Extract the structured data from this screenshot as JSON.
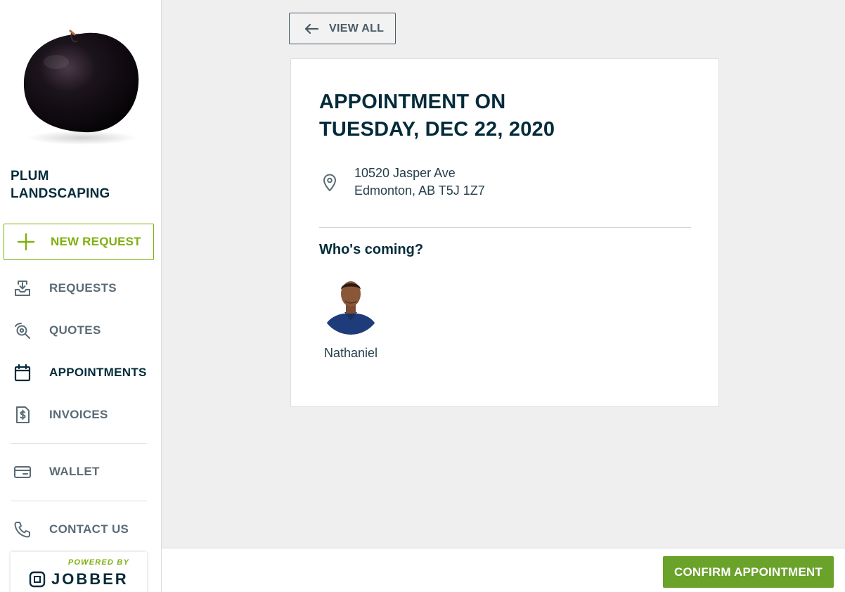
{
  "sidebar": {
    "company_name": "PLUM LANDSCAPING",
    "new_request_label": "NEW REQUEST",
    "nav": [
      {
        "label": "REQUESTS",
        "icon": "inbox-download-icon",
        "active": false
      },
      {
        "label": "QUOTES",
        "icon": "quote-magnifier-icon",
        "active": false
      },
      {
        "label": "APPOINTMENTS",
        "icon": "calendar-icon",
        "active": true
      },
      {
        "label": "INVOICES",
        "icon": "invoice-dollar-icon",
        "active": false
      },
      {
        "label": "WALLET",
        "icon": "credit-card-icon",
        "active": false
      },
      {
        "label": "CONTACT US",
        "icon": "phone-icon",
        "active": false
      }
    ],
    "powered_by": "POWERED BY",
    "brand": "JOBBER"
  },
  "main": {
    "view_all_label": "VIEW ALL",
    "appointment": {
      "title_line1": "APPOINTMENT ON",
      "title_line2": "TUESDAY, DEC 22, 2020",
      "address_line1": "10520 Jasper Ave",
      "address_line2": "Edmonton, AB T5J 1Z7",
      "who_heading": "Who's coming?",
      "people": [
        {
          "name": "Nathaniel"
        }
      ]
    }
  },
  "footer": {
    "confirm_label": "CONFIRM APPOINTMENT"
  },
  "colors": {
    "brand_green": "#7db00e",
    "confirm_green": "#6aa22a",
    "navy": "#032b3a",
    "muted": "#5a6b76"
  }
}
